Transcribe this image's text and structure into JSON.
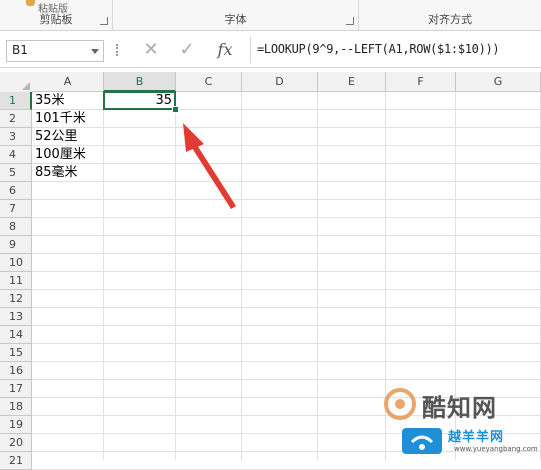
{
  "ribbon": {
    "groups": [
      "剪贴板",
      "字体",
      "对齐方式"
    ],
    "partial_label": "粘贴版"
  },
  "formula_bar": {
    "name_box": "B1",
    "cancel_icon": "close-icon",
    "confirm_icon": "check-icon",
    "fx_label": "fx",
    "formula": "=LOOKUP(9^9,--LEFT(A1,ROW($1:$10)))"
  },
  "sheet": {
    "columns": [
      "A",
      "B",
      "C",
      "D",
      "E",
      "F",
      "G"
    ],
    "selected_column": "B",
    "rows": [
      "1",
      "2",
      "3",
      "4",
      "5",
      "6",
      "7",
      "8",
      "9",
      "10",
      "11",
      "12",
      "13",
      "14",
      "15",
      "16",
      "17",
      "18",
      "19",
      "20",
      "21"
    ],
    "selected_row": "1",
    "column_a": [
      "35米",
      "101千米",
      "52公里",
      "100厘米",
      "85毫米"
    ],
    "b1_value": "35",
    "selected_cell": "B1"
  },
  "annotation": {
    "arrow_color": "#e03c31"
  },
  "watermark": {
    "brand": "酷知网",
    "sub": "越羊羊网",
    "url": "www.yueyangbang.com"
  },
  "colors": {
    "accent": "#217346",
    "header_bg": "#f2f2f2",
    "grid_line": "#e0e0e0"
  }
}
